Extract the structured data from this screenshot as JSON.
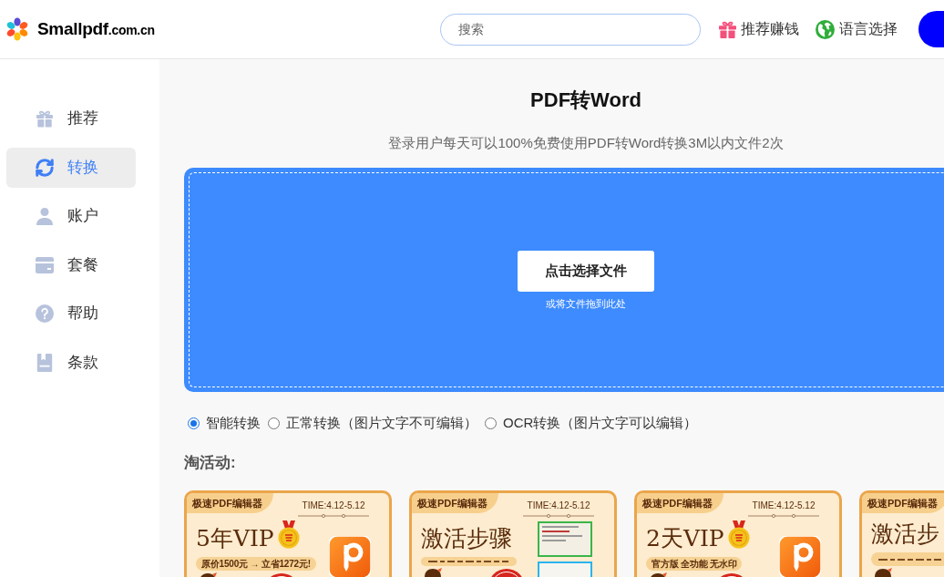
{
  "header": {
    "logo": {
      "name": "Smallpdf",
      "suffix": ".com.cn"
    },
    "search": {
      "placeholder": "搜索"
    },
    "links": [
      {
        "kind": "gift",
        "label": "推荐赚钱"
      },
      {
        "kind": "globe",
        "label": "语言选择"
      }
    ]
  },
  "sidebar": {
    "items": [
      {
        "label": "推荐",
        "selected": false
      },
      {
        "label": "转换",
        "selected": true
      },
      {
        "label": "账户",
        "selected": false
      },
      {
        "label": "套餐",
        "selected": false
      },
      {
        "label": "帮助",
        "selected": false
      },
      {
        "label": "条款",
        "selected": false
      }
    ]
  },
  "main": {
    "title": "PDF转Word",
    "subtitle": "登录用户每天可以100%免费使用PDF转Word转换3M以内文件2次",
    "upload": {
      "button": "点击选择文件",
      "hint": "或将文件拖到此处"
    },
    "modes": [
      {
        "label": "智能转换",
        "selected": true
      },
      {
        "label": "正常转换（图片文字不可编辑）",
        "selected": false
      },
      {
        "label": "OCR转换（图片文字可以编辑）",
        "selected": false
      }
    ],
    "promotions": {
      "heading": "淘活动:",
      "cards": [
        {
          "kind": "offer",
          "brand": "极速PDF编辑器",
          "time": "TIME:4.12-5.12",
          "headline": "5年VIP",
          "tagline": "原价1500元 → 立省1272元!"
        },
        {
          "kind": "steps",
          "brand": "极速PDF编辑器",
          "time": "TIME:4.12-5.12",
          "headline": "激活步骤"
        },
        {
          "kind": "offer",
          "brand": "极速PDF编辑器",
          "time": "TIME:4.12-5.12",
          "headline": "2天VIP",
          "tagline": "官方版 全功能 无水印"
        },
        {
          "kind": "steps",
          "brand": "极速PDF编辑器",
          "headline": "激活步"
        }
      ]
    }
  }
}
